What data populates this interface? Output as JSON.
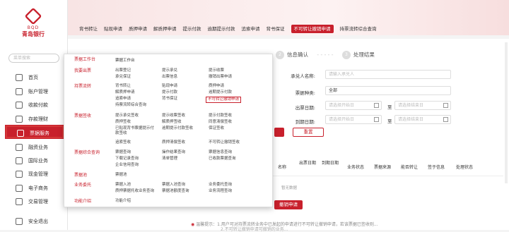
{
  "sidebar": {
    "logo_en": "BQD",
    "logo_cn": "青岛银行",
    "search_placeholder": "菜单搜索",
    "items": [
      {
        "label": "首页",
        "icon": "home-icon"
      },
      {
        "label": "账户管理",
        "icon": "account-icon"
      },
      {
        "label": "收款付款",
        "icon": "payment-icon"
      },
      {
        "label": "存款理财",
        "icon": "deposit-icon"
      },
      {
        "label": "票据服务",
        "icon": "bill-icon"
      },
      {
        "label": "融资业务",
        "icon": "finance-icon"
      },
      {
        "label": "国际业务",
        "icon": "globe-icon"
      },
      {
        "label": "现金管理",
        "icon": "cash-icon"
      },
      {
        "label": "电子商务",
        "icon": "ecommerce-icon"
      },
      {
        "label": "交易管理",
        "icon": "trade-icon"
      },
      {
        "label": "安全退出",
        "icon": "logout-icon"
      }
    ]
  },
  "tabs": [
    "背书转让",
    "贴现申请",
    "质押申请",
    "解质押申请",
    "提示付款",
    "逾期提示付款",
    "追索申请",
    "背书保证",
    "不可转让撤销申请",
    "持票流转综合查询"
  ],
  "steps": {
    "s2": "信息确认",
    "s3": "处理结果"
  },
  "form": {
    "acceptor_label": "承兑人名称:",
    "acceptor_ph": "请输入承兑人",
    "bill_type_label": "票据种类:",
    "bill_type_val": "全部",
    "issue_label": "出票日期:",
    "due_label": "到期日期:",
    "start_ph": "请选择开始日",
    "end_ph": "请选择结束日",
    "sep": "至",
    "reset": "重置"
  },
  "table": {
    "cols": [
      "名称",
      "出票日期",
      "到期日期",
      "业务状态",
      "票据来源",
      "能否转让",
      "签于信息",
      "处理状态"
    ],
    "empty": "暂无数据",
    "submit": "撤销申请"
  },
  "menu": {
    "top": "票据工作台",
    "cats": [
      {
        "name": "票据工作台",
        "items": []
      },
      {
        "name": "我要出票",
        "items": [
          "出票登记",
          "提示承兑",
          "提示收票",
          "承兑保证",
          "出票信息",
          "撤销出票申请"
        ]
      },
      {
        "name": "持票流转",
        "items": [
          "背书转让",
          "贴现申请",
          "质押申请",
          "解质押申请",
          "提示付款",
          "逾期提示付款",
          "追索申请",
          "背书保证",
          "不可转让撤销申请",
          "持票流转综合查询"
        ]
      },
      {
        "name": "票据签收",
        "items": [
          "提示承兑签收",
          "提示收票签收",
          "提示付款签收",
          "质押签收",
          "解质押签收",
          "同意清偿签收",
          "已贴现背书票据提示付款签收",
          "逾期提示付款签收",
          "保证签收",
          "追索签收",
          "质押清偿签收",
          "不可转让撤销签收"
        ]
      },
      {
        "name": "票据综合查询",
        "items": [
          "票据查询",
          "操作结果查询",
          "票据信息查询",
          "下载记录查询",
          "清单管理",
          "已收款票据查询",
          "企业信用查询"
        ]
      },
      {
        "name": "票据池",
        "items": [
          "票据池"
        ]
      },
      {
        "name": "业务委托",
        "items": [
          "票据入池",
          "票据入池查询",
          "业务委托查询",
          "质押票据托收业务查询",
          "票据池额度查询",
          "业务流程查询"
        ]
      },
      {
        "name": "功能介绍",
        "items": [
          "功能介绍"
        ]
      }
    ]
  },
  "footer": {
    "tip": "温馨提示：1.用户可对持票流转业务中已发起的申请进行不可转让撤销申请，若该票据已签收则...",
    "tip2": "2.不可转让撤销申请可撤销的业务..."
  }
}
